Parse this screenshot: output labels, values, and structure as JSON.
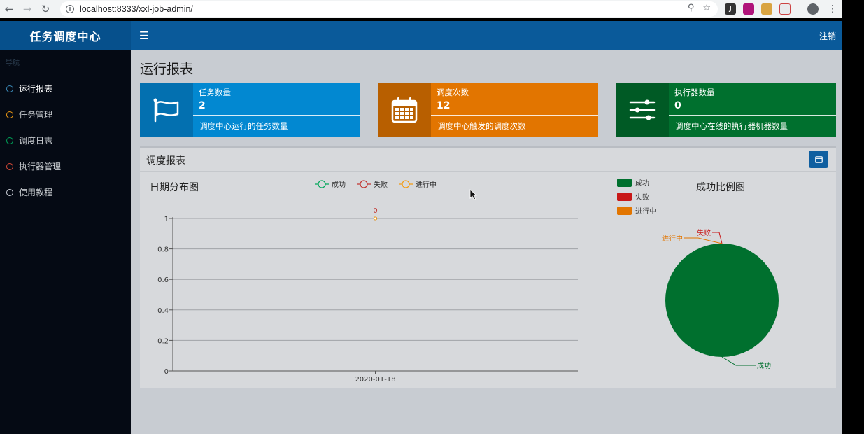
{
  "browser": {
    "url": "localhost:8333/xxl-job-admin/",
    "ext_j": "J"
  },
  "header": {
    "brand": "任务调度中心",
    "logout": "注销"
  },
  "sidebar": {
    "nav_header": "导航",
    "items": [
      {
        "label": "运行报表",
        "color": "#3c8dbc"
      },
      {
        "label": "任务管理",
        "color": "#f39c12"
      },
      {
        "label": "调度日志",
        "color": "#00a65a"
      },
      {
        "label": "执行器管理",
        "color": "#dd4b39"
      },
      {
        "label": "使用教程",
        "color": "#d2d6de"
      }
    ]
  },
  "page": {
    "title": "运行报表"
  },
  "info_boxes": [
    {
      "label": "任务数量",
      "value": "2",
      "desc": "调度中心运行的任务数量",
      "icon": "flag-icon",
      "color": "#0288d1",
      "icon_bg": "#0370b0"
    },
    {
      "label": "调度次数",
      "value": "12",
      "desc": "调度中心触发的调度次数",
      "icon": "calendar-icon",
      "color": "#e27500",
      "icon_bg": "#b85f00"
    },
    {
      "label": "执行器数量",
      "value": "0",
      "desc": "调度中心在线的执行器机器数量",
      "icon": "sliders-icon",
      "color": "#00702e",
      "icon_bg": "#005a25"
    }
  ],
  "report": {
    "title": "调度报表",
    "date_chart_title": "日期分布图",
    "pie_chart_title": "成功比例图"
  },
  "chart_data": [
    {
      "type": "line",
      "title": "日期分布图",
      "x": [
        "2020-01-18"
      ],
      "ylim": [
        0,
        1
      ],
      "yticks": [
        "0",
        "0.2",
        "0.4",
        "0.6",
        "0.8",
        "1"
      ],
      "grid": true,
      "legend_placement": "top-center",
      "series": [
        {
          "name": "成功",
          "values": [
            0
          ],
          "color": "#00a65a"
        },
        {
          "name": "失败",
          "values": [
            0
          ],
          "color": "#c23531"
        },
        {
          "name": "进行中",
          "values": [
            0
          ],
          "color": "#f39c12"
        }
      ],
      "data_labels": [
        "0"
      ]
    },
    {
      "type": "pie",
      "title": "成功比例图",
      "legend_placement": "top-left",
      "slices": [
        {
          "name": "成功",
          "value": 12,
          "color": "#00702e"
        },
        {
          "name": "失败",
          "value": 0,
          "color": "#c81818"
        },
        {
          "name": "进行中",
          "value": 0,
          "color": "#e27500"
        }
      ]
    }
  ]
}
